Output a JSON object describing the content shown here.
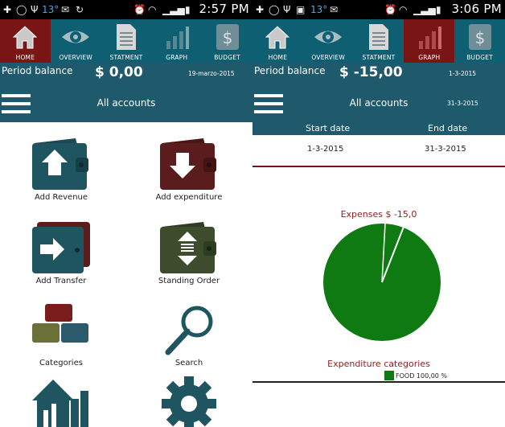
{
  "left": {
    "status": {
      "temp": "13°",
      "time": "2:57 PM"
    },
    "tabs": [
      {
        "label": "HOME",
        "icon": "home-icon",
        "active": true
      },
      {
        "label": "OVERVIEW",
        "icon": "eye-icon",
        "active": false
      },
      {
        "label": "STATMENT",
        "icon": "document-icon",
        "active": false
      },
      {
        "label": "GRAPH",
        "icon": "bar-graph-icon",
        "active": false
      },
      {
        "label": "BUDGET",
        "icon": "dollar-doc-icon",
        "active": false
      }
    ],
    "balance": {
      "label": "Period balance",
      "value": "$ 0,00",
      "date": "19-marzo-2015"
    },
    "accounts": {
      "label": "All accounts"
    },
    "menu": [
      {
        "label": "Add Revenue",
        "icon": "wallet-up-arrow-icon"
      },
      {
        "label": "Add expenditure",
        "icon": "wallet-down-arrow-icon"
      },
      {
        "label": "Add Transfer",
        "icon": "wallet-right-arrow-icon"
      },
      {
        "label": "Standing Order",
        "icon": "wallet-exchange-icon"
      },
      {
        "label": "Categories",
        "icon": "blocks-icon"
      },
      {
        "label": "Search",
        "icon": "magnifier-icon"
      },
      {
        "label": "",
        "icon": "house-chart-icon"
      },
      {
        "label": "",
        "icon": "gear-icon"
      }
    ]
  },
  "right": {
    "status": {
      "temp": "13°",
      "time": "3:06 PM"
    },
    "tabs": [
      {
        "label": "HOME",
        "icon": "home-icon",
        "active": false
      },
      {
        "label": "OVERVIEW",
        "icon": "eye-icon",
        "active": false
      },
      {
        "label": "STATMENT",
        "icon": "document-icon",
        "active": false
      },
      {
        "label": "GRAPH",
        "icon": "bar-graph-icon",
        "active": true
      },
      {
        "label": "BUDGET",
        "icon": "dollar-doc-icon",
        "active": false
      }
    ],
    "balance": {
      "label": "Period balance",
      "value": "$ -15,00",
      "date": "1-3-2015"
    },
    "accounts": {
      "label": "All accounts",
      "date": "31-3-2015"
    },
    "dates": {
      "start_header": "Start date",
      "end_header": "End date",
      "start_value": "1-3-2015",
      "end_value": "31-3-2015"
    },
    "chart_data": {
      "type": "pie",
      "title": "Expenses $ -15,0",
      "legend_title": "Expenditure categories",
      "slices": [
        {
          "label": "FOOD 100,00 %",
          "value": 100,
          "color": "#0f7a12"
        }
      ],
      "legend_position": "bottom"
    }
  },
  "colors": {
    "nav": "#0f5f73",
    "nav_active": "#7a1515",
    "balance_bar": "#1e5a6c",
    "pie": "#0f7a12",
    "accent_text": "#8b1f1f"
  }
}
